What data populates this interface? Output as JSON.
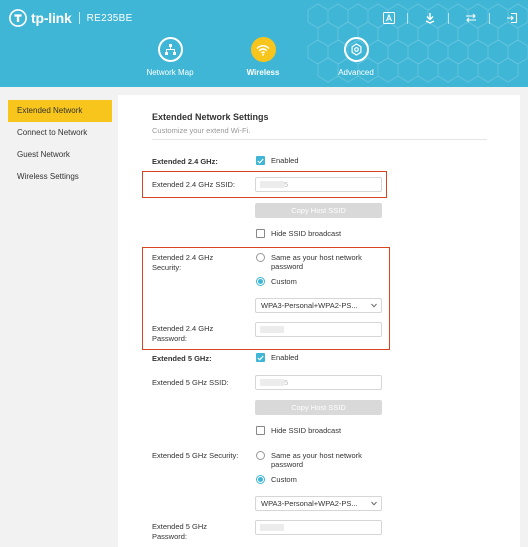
{
  "header": {
    "brand": "tp-link",
    "model": "RE235BE",
    "icons": [
      "font-size-icon",
      "download-icon",
      "transfer-icon",
      "logout-icon"
    ],
    "accent": "#3fb6d6",
    "active_color": "#f7c51b"
  },
  "nav": [
    {
      "label": "Network Map",
      "icon": "network-map-icon",
      "active": false
    },
    {
      "label": "Wireless",
      "icon": "wifi-icon",
      "active": true
    },
    {
      "label": "Advanced",
      "icon": "gear-icon",
      "active": false
    }
  ],
  "sidebar": [
    {
      "label": "Extended Network",
      "active": true
    },
    {
      "label": "Connect to Network",
      "active": false
    },
    {
      "label": "Guest Network",
      "active": false
    },
    {
      "label": "Wireless Settings",
      "active": false
    }
  ],
  "panel": {
    "title": "Extended Network Settings",
    "subtitle": "Customize your extend Wi-Fi.",
    "band24": {
      "label": "Extended 2.4 GHz:",
      "enabled_label": "Enabled",
      "enabled": true,
      "ssid_label": "Extended 2.4 GHz SSID:",
      "ssid_suffix": "5",
      "copy_label": "Copy Host SSID",
      "hide_label": "Hide SSID broadcast",
      "hide": false,
      "security_label_1": "Extended 2.4 GHz",
      "security_label_2": "Security:",
      "opt_same_1": "Same as your host network",
      "opt_same_2": "password",
      "opt_custom": "Custom",
      "selected": "custom",
      "security_value": "WPA3-Personal+WPA2-PS...",
      "password_label_1": "Extended 2.4 GHz",
      "password_label_2": "Password:"
    },
    "band5": {
      "label": "Extended 5 GHz:",
      "enabled_label": "Enabled",
      "enabled": true,
      "ssid_label": "Extended 5 GHz SSID:",
      "ssid_suffix": "5",
      "copy_label": "Copy Host SSID",
      "hide_label": "Hide SSID broadcast",
      "hide": false,
      "security_label": "Extended 5 GHz Security:",
      "opt_same_1": "Same as your host network",
      "opt_same_2": "password",
      "opt_custom": "Custom",
      "selected": "custom",
      "security_value": "WPA3-Personal+WPA2-PS...",
      "password_label_1": "Extended 5 GHz",
      "password_label_2": "Password:"
    }
  }
}
